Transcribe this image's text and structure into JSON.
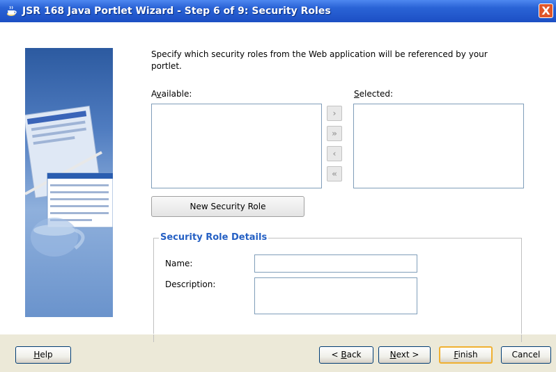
{
  "window": {
    "title": "JSR 168 Java Portlet Wizard - Step 6 of 9: Security Roles",
    "close_label": "X"
  },
  "intro": {
    "text": "Specify which security roles from the Web application will be referenced by your portlet."
  },
  "available": {
    "label_pre": "A",
    "label_mn": "v",
    "label_post": "ailable:"
  },
  "selected": {
    "label_mn": "S",
    "label_post": "elected:"
  },
  "shuttle": {
    "add": "›",
    "add_all": "»",
    "remove": "‹",
    "remove_all": "«"
  },
  "new_role_button": "New Security Role",
  "details": {
    "legend": "Security Role Details",
    "name_label": "Name:",
    "description_label": "Description:"
  },
  "footer": {
    "help_mn": "H",
    "help_rest": "elp",
    "back_pre": "< ",
    "back_mn": "B",
    "back_rest": "ack",
    "next_mn": "N",
    "next_rest": "ext >",
    "finish_mn": "F",
    "finish_rest": "inish",
    "cancel": "Cancel"
  },
  "colors": {
    "title_bar": "#2a63d6",
    "legend": "#2560c4",
    "close": "#e0562a"
  }
}
